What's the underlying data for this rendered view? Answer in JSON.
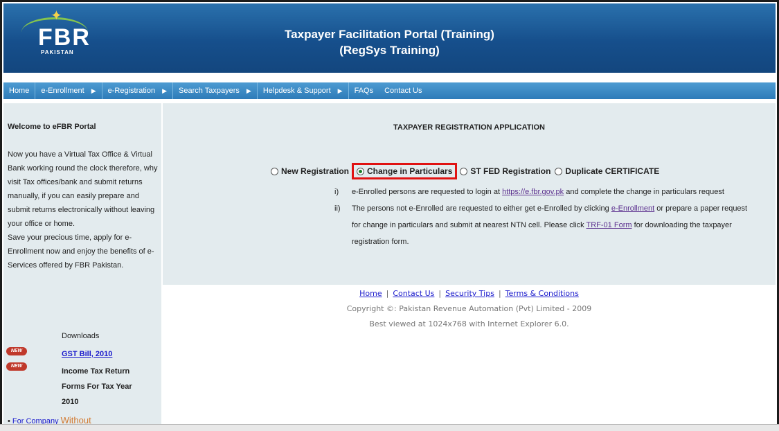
{
  "header": {
    "logo_text": "FBR",
    "logo_sub": "PAKISTAN",
    "title_line1": "Taxpayer Facilitation Portal (Training)",
    "title_line2": "(RegSys Training)"
  },
  "nav": {
    "items": [
      {
        "label": "Home"
      },
      {
        "label": "e-Enrollment"
      },
      {
        "label": "e-Registration"
      },
      {
        "label": "Search Taxpayers"
      },
      {
        "label": "Helpdesk & Support"
      },
      {
        "label": "FAQs"
      },
      {
        "label": "Contact Us"
      }
    ]
  },
  "sidebar": {
    "title": "Welcome to eFBR Portal",
    "text1": "Now you have a Virtual Tax Office & Virtual Bank working round the clock therefore, why visit Tax offices/bank and submit returns manually, if you can easily prepare and submit returns electronically without leaving your office or home.",
    "text2": "Save your precious time, apply for e-Enrollment now and enjoy the benefits of e-Services offered by FBR Pakistan.",
    "downloads_label": "Downloads",
    "new_badge": "NEW",
    "gst_link": "GST Bill, 2010",
    "income_line1": "Income Tax Return",
    "income_line2": "Forms For Tax Year",
    "income_line3": "2010",
    "bullet_link": "For Company",
    "bullet_text": "Without"
  },
  "main": {
    "app_title": "TAXPAYER REGISTRATION APPLICATION",
    "radios": {
      "new_registration": "New Registration",
      "change_in_particulars": "Change in Particulars",
      "st_fed_registration": "ST FED Registration",
      "duplicate_certificate": "Duplicate CERTIFICATE"
    },
    "note1_num": "i)",
    "note1_pre": "e-Enrolled persons are requested to login at ",
    "note1_link": "https://e.fbr.gov.pk",
    "note1_post": " and complete the change in particulars request",
    "note2_num": "ii)",
    "note2_pre": "The persons not e-Enrolled are requested to either get e-Enrolled by clicking ",
    "note2_link1": "e-Enrollment",
    "note2_mid": " or prepare a paper request for change in particulars and submit at nearest NTN cell. Please click ",
    "note2_link2": "TRF-01 Form",
    "note2_post": " for downloading the taxpayer registration form."
  },
  "footer": {
    "links": [
      "Home",
      "Contact Us",
      "Security Tips",
      "Terms & Conditions"
    ],
    "separator": "|",
    "copyright": "Copyright ©: Pakistan Revenue Automation (Pvt) Limited - 2009",
    "best_viewed": "Best viewed at 1024x768 with Internet Explorer 6.0."
  }
}
